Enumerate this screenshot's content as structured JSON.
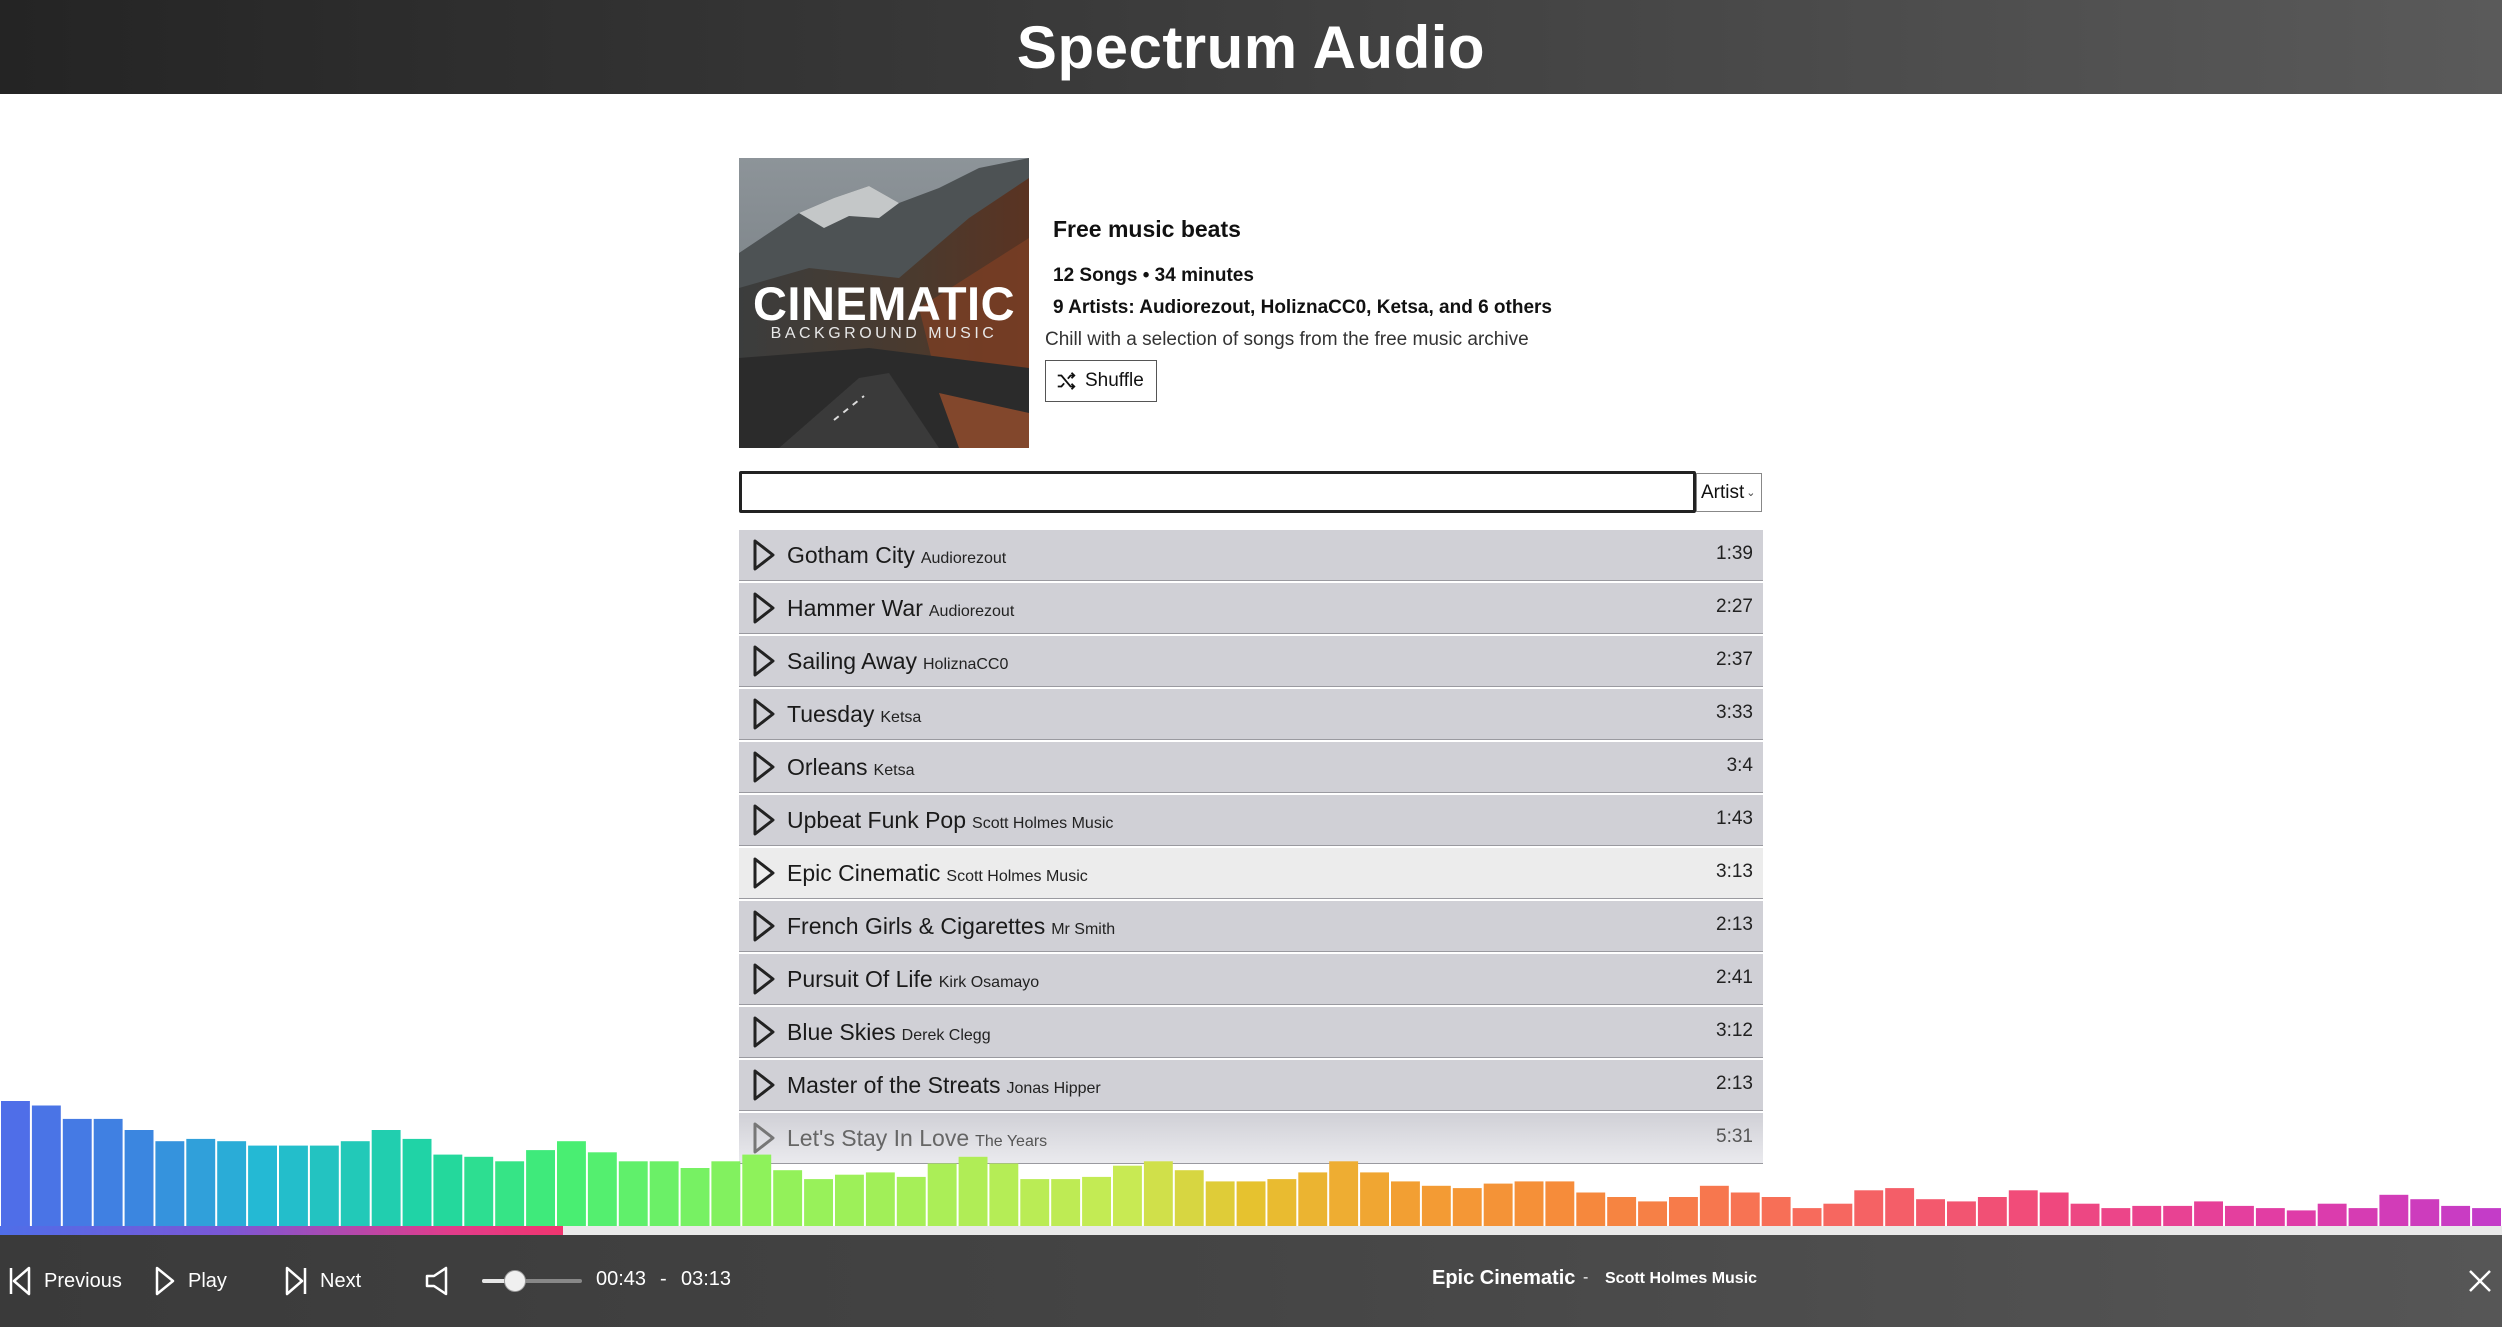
{
  "app": {
    "title": "Spectrum Audio"
  },
  "album": {
    "cover_title": "CINEMATIC",
    "cover_subtitle": "BACKGROUND MUSIC",
    "name": "Free music beats",
    "stats": "12 Songs • 34 minutes",
    "artists": "9 Artists: Audiorezout, HoliznaCC0, Ketsa, and 6 others",
    "description": "Chill with a selection of songs from the free music archive",
    "shuffle_label": "Shuffle"
  },
  "search": {
    "value": "",
    "placeholder": ""
  },
  "filter": {
    "selected": "Artist"
  },
  "tracks": [
    {
      "title": "Gotham City",
      "artist": "Audiorezout",
      "duration": "1:39"
    },
    {
      "title": "Hammer War",
      "artist": "Audiorezout",
      "duration": "2:27"
    },
    {
      "title": "Sailing Away",
      "artist": "HoliznaCC0",
      "duration": "2:37"
    },
    {
      "title": "Tuesday",
      "artist": "Ketsa",
      "duration": "3:33"
    },
    {
      "title": "Orleans",
      "artist": "Ketsa",
      "duration": "3:4"
    },
    {
      "title": "Upbeat Funk Pop",
      "artist": "Scott Holmes Music",
      "duration": "1:43"
    },
    {
      "title": "Epic Cinematic",
      "artist": "Scott Holmes Music",
      "duration": "3:13",
      "active": true
    },
    {
      "title": "French Girls & Cigarettes",
      "artist": "Mr Smith",
      "duration": "2:13"
    },
    {
      "title": "Pursuit Of Life",
      "artist": "Kirk Osamayo",
      "duration": "2:41"
    },
    {
      "title": "Blue Skies",
      "artist": "Derek Clegg",
      "duration": "3:12"
    },
    {
      "title": "Master of the Streats",
      "artist": "Jonas Hipper",
      "duration": "2:13"
    },
    {
      "title": "Let's Stay In Love",
      "artist": "The Years",
      "duration": "5:31"
    }
  ],
  "visualizer": {
    "levels": [
      0.56,
      0.54,
      0.48,
      0.48,
      0.43,
      0.38,
      0.39,
      0.38,
      0.36,
      0.36,
      0.36,
      0.38,
      0.43,
      0.39,
      0.32,
      0.31,
      0.29,
      0.34,
      0.38,
      0.33,
      0.29,
      0.29,
      0.26,
      0.29,
      0.32,
      0.25,
      0.21,
      0.23,
      0.24,
      0.22,
      0.28,
      0.31,
      0.28,
      0.21,
      0.21,
      0.22,
      0.27,
      0.29,
      0.25,
      0.2,
      0.2,
      0.21,
      0.24,
      0.29,
      0.24,
      0.2,
      0.18,
      0.17,
      0.19,
      0.2,
      0.2,
      0.15,
      0.13,
      0.11,
      0.13,
      0.18,
      0.15,
      0.13,
      0.08,
      0.1,
      0.16,
      0.17,
      0.12,
      0.11,
      0.13,
      0.16,
      0.15,
      0.1,
      0.08,
      0.09,
      0.09,
      0.11,
      0.09,
      0.08,
      0.07,
      0.1,
      0.08,
      0.14,
      0.12,
      0.09,
      0.08
    ]
  },
  "player": {
    "previous_label": "Previous",
    "play_label": "Play",
    "next_label": "Next",
    "current_time": "00:43",
    "time_separator": "-",
    "total_time": "03:13",
    "progress": 0.225,
    "volume": 0.33,
    "now_playing_title": "Epic Cinematic",
    "now_playing_separator": "-",
    "now_playing_artist": "Scott Holmes Music"
  },
  "icons": {
    "shuffle": "shuffle-icon",
    "play": "play-icon",
    "previous": "skip-previous-icon",
    "next": "skip-next-icon",
    "volume": "speaker-icon",
    "close": "close-icon"
  }
}
